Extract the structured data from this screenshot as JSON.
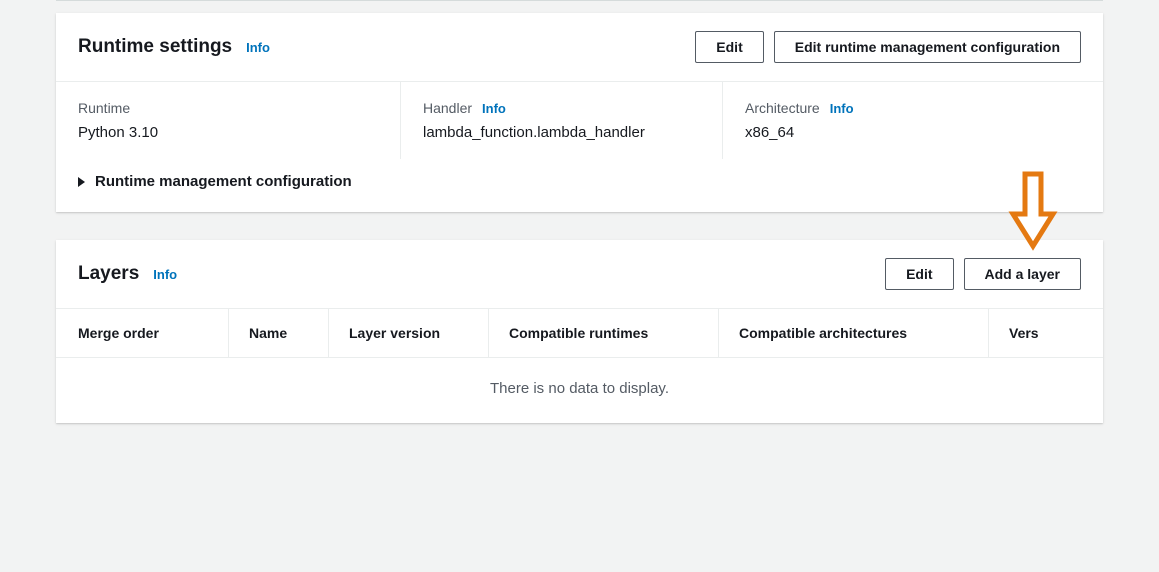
{
  "runtime_panel": {
    "title": "Runtime settings",
    "info": "Info",
    "edit_label": "Edit",
    "edit_config_label": "Edit runtime management configuration",
    "runtime": {
      "label": "Runtime",
      "value": "Python 3.10"
    },
    "handler": {
      "label": "Handler",
      "info": "Info",
      "value": "lambda_function.lambda_handler"
    },
    "architecture": {
      "label": "Architecture",
      "info": "Info",
      "value": "x86_64"
    },
    "expander_label": "Runtime management configuration"
  },
  "layers_panel": {
    "title": "Layers",
    "info": "Info",
    "edit_label": "Edit",
    "add_label": "Add a layer",
    "columns": {
      "merge_order": "Merge order",
      "name": "Name",
      "layer_version": "Layer version",
      "compatible_runtimes": "Compatible runtimes",
      "compatible_architectures": "Compatible architectures",
      "version": "Vers"
    },
    "empty_message": "There is no data to display."
  }
}
